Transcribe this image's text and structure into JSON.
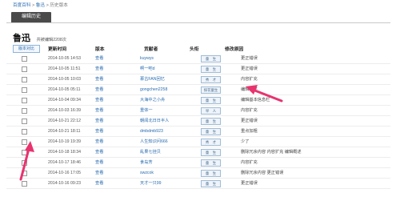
{
  "breadcrumb": {
    "home": "百度百科",
    "sep1": ">",
    "entry": "鲁迅",
    "sep2": ">",
    "current": "历史版本"
  },
  "tab": "编辑历史",
  "entry": {
    "name": "鲁迅",
    "count": "共被编辑2208次"
  },
  "compare_button": "版本对比",
  "columns": [
    "更新时间",
    "版本",
    "贡献者",
    "头衔",
    "修改原因"
  ],
  "rows": [
    {
      "time": "2014-10-05 14:53",
      "view": "查看",
      "editor": "kuywys",
      "title": "童　生",
      "reason": "更正错误"
    },
    {
      "time": "2014-10-05 11:51",
      "view": "查看",
      "editor": "啊一吧d",
      "title": "童　生",
      "reason": "更正错误"
    },
    {
      "time": "2014-10-05 10:03",
      "view": "查看",
      "editor": "慕古FAN回忆",
      "title": "秀　才",
      "reason": "内容扩充"
    },
    {
      "time": "2014-10-05 05:11",
      "view": "查看",
      "editor": "gongchen2258",
      "title": "探花童生",
      "reason": "编辑概述"
    },
    {
      "time": "2014-10-04 09:34",
      "view": "查看",
      "editor": "大海中之小舟",
      "title": "童　生",
      "reason": "编辑基本信息栏"
    },
    {
      "time": "2014-10-03 16:39",
      "view": "查看",
      "editor": "重体一",
      "title": "举　人",
      "reason": "内容扩充"
    },
    {
      "time": "2014-10-21 22:12",
      "view": "查看",
      "editor": "朝闻北日日半人",
      "title": "童　生",
      "reason": "更正错误"
    },
    {
      "time": "2014-10-21 18:11",
      "view": "查看",
      "editor": "dmbdmb923",
      "title": "童　生",
      "reason": "重点加粗"
    },
    {
      "time": "2014-10-19 19:39",
      "view": "查看",
      "editor": "人生知识问666",
      "title": "秀　才",
      "reason": "少了"
    },
    {
      "time": "2014-10-18 18:34",
      "view": "查看",
      "editor": "乱果七挂贝",
      "title": "童　生",
      "reason": "删除冗余内容 内容扩充 编辑概述"
    },
    {
      "time": "2014-10-17 18:46",
      "view": "查看",
      "editor": "食岛芳",
      "title": "童　生",
      "reason": "内容扩充"
    },
    {
      "time": "2014-10-16 17:05",
      "view": "查看",
      "editor": "swzcok",
      "title": "童　生",
      "reason": "删除冗余内容 更正错误"
    },
    {
      "time": "2014-10-16 09:23",
      "view": "查看",
      "editor": "天才一只99",
      "title": "童　生",
      "reason": "更正错误"
    }
  ],
  "colors": {
    "link": "#2a6cb0",
    "tab_bg": "#4a4a4a",
    "arrow": "#e8336e"
  }
}
